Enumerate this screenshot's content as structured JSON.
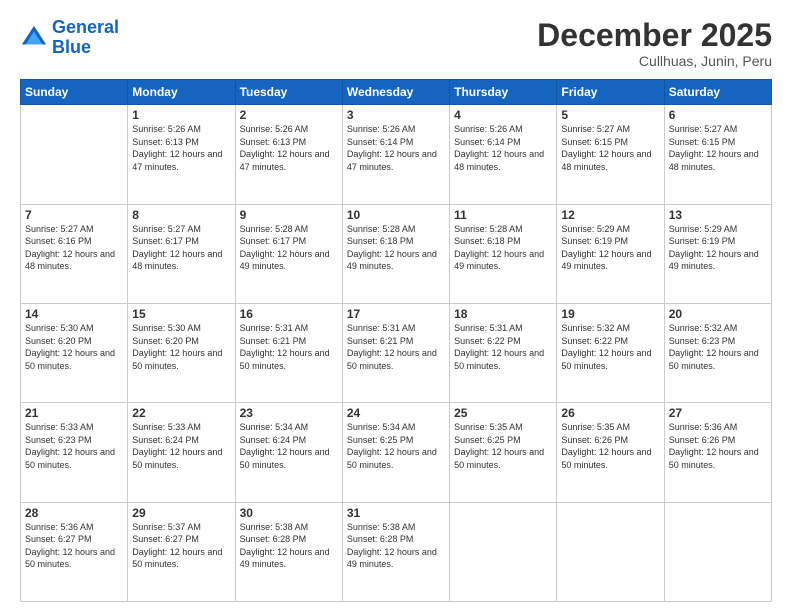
{
  "logo": {
    "line1": "General",
    "line2": "Blue"
  },
  "title": "December 2025",
  "subtitle": "Cullhuas, Junin, Peru",
  "weekdays": [
    "Sunday",
    "Monday",
    "Tuesday",
    "Wednesday",
    "Thursday",
    "Friday",
    "Saturday"
  ],
  "weeks": [
    [
      {
        "day": "",
        "sunrise": "",
        "sunset": "",
        "daylight": ""
      },
      {
        "day": "1",
        "sunrise": "Sunrise: 5:26 AM",
        "sunset": "Sunset: 6:13 PM",
        "daylight": "Daylight: 12 hours and 47 minutes."
      },
      {
        "day": "2",
        "sunrise": "Sunrise: 5:26 AM",
        "sunset": "Sunset: 6:13 PM",
        "daylight": "Daylight: 12 hours and 47 minutes."
      },
      {
        "day": "3",
        "sunrise": "Sunrise: 5:26 AM",
        "sunset": "Sunset: 6:14 PM",
        "daylight": "Daylight: 12 hours and 47 minutes."
      },
      {
        "day": "4",
        "sunrise": "Sunrise: 5:26 AM",
        "sunset": "Sunset: 6:14 PM",
        "daylight": "Daylight: 12 hours and 48 minutes."
      },
      {
        "day": "5",
        "sunrise": "Sunrise: 5:27 AM",
        "sunset": "Sunset: 6:15 PM",
        "daylight": "Daylight: 12 hours and 48 minutes."
      },
      {
        "day": "6",
        "sunrise": "Sunrise: 5:27 AM",
        "sunset": "Sunset: 6:15 PM",
        "daylight": "Daylight: 12 hours and 48 minutes."
      }
    ],
    [
      {
        "day": "7",
        "sunrise": "Sunrise: 5:27 AM",
        "sunset": "Sunset: 6:16 PM",
        "daylight": "Daylight: 12 hours and 48 minutes."
      },
      {
        "day": "8",
        "sunrise": "Sunrise: 5:27 AM",
        "sunset": "Sunset: 6:17 PM",
        "daylight": "Daylight: 12 hours and 48 minutes."
      },
      {
        "day": "9",
        "sunrise": "Sunrise: 5:28 AM",
        "sunset": "Sunset: 6:17 PM",
        "daylight": "Daylight: 12 hours and 49 minutes."
      },
      {
        "day": "10",
        "sunrise": "Sunrise: 5:28 AM",
        "sunset": "Sunset: 6:18 PM",
        "daylight": "Daylight: 12 hours and 49 minutes."
      },
      {
        "day": "11",
        "sunrise": "Sunrise: 5:28 AM",
        "sunset": "Sunset: 6:18 PM",
        "daylight": "Daylight: 12 hours and 49 minutes."
      },
      {
        "day": "12",
        "sunrise": "Sunrise: 5:29 AM",
        "sunset": "Sunset: 6:19 PM",
        "daylight": "Daylight: 12 hours and 49 minutes."
      },
      {
        "day": "13",
        "sunrise": "Sunrise: 5:29 AM",
        "sunset": "Sunset: 6:19 PM",
        "daylight": "Daylight: 12 hours and 49 minutes."
      }
    ],
    [
      {
        "day": "14",
        "sunrise": "Sunrise: 5:30 AM",
        "sunset": "Sunset: 6:20 PM",
        "daylight": "Daylight: 12 hours and 50 minutes."
      },
      {
        "day": "15",
        "sunrise": "Sunrise: 5:30 AM",
        "sunset": "Sunset: 6:20 PM",
        "daylight": "Daylight: 12 hours and 50 minutes."
      },
      {
        "day": "16",
        "sunrise": "Sunrise: 5:31 AM",
        "sunset": "Sunset: 6:21 PM",
        "daylight": "Daylight: 12 hours and 50 minutes."
      },
      {
        "day": "17",
        "sunrise": "Sunrise: 5:31 AM",
        "sunset": "Sunset: 6:21 PM",
        "daylight": "Daylight: 12 hours and 50 minutes."
      },
      {
        "day": "18",
        "sunrise": "Sunrise: 5:31 AM",
        "sunset": "Sunset: 6:22 PM",
        "daylight": "Daylight: 12 hours and 50 minutes."
      },
      {
        "day": "19",
        "sunrise": "Sunrise: 5:32 AM",
        "sunset": "Sunset: 6:22 PM",
        "daylight": "Daylight: 12 hours and 50 minutes."
      },
      {
        "day": "20",
        "sunrise": "Sunrise: 5:32 AM",
        "sunset": "Sunset: 6:23 PM",
        "daylight": "Daylight: 12 hours and 50 minutes."
      }
    ],
    [
      {
        "day": "21",
        "sunrise": "Sunrise: 5:33 AM",
        "sunset": "Sunset: 6:23 PM",
        "daylight": "Daylight: 12 hours and 50 minutes."
      },
      {
        "day": "22",
        "sunrise": "Sunrise: 5:33 AM",
        "sunset": "Sunset: 6:24 PM",
        "daylight": "Daylight: 12 hours and 50 minutes."
      },
      {
        "day": "23",
        "sunrise": "Sunrise: 5:34 AM",
        "sunset": "Sunset: 6:24 PM",
        "daylight": "Daylight: 12 hours and 50 minutes."
      },
      {
        "day": "24",
        "sunrise": "Sunrise: 5:34 AM",
        "sunset": "Sunset: 6:25 PM",
        "daylight": "Daylight: 12 hours and 50 minutes."
      },
      {
        "day": "25",
        "sunrise": "Sunrise: 5:35 AM",
        "sunset": "Sunset: 6:25 PM",
        "daylight": "Daylight: 12 hours and 50 minutes."
      },
      {
        "day": "26",
        "sunrise": "Sunrise: 5:35 AM",
        "sunset": "Sunset: 6:26 PM",
        "daylight": "Daylight: 12 hours and 50 minutes."
      },
      {
        "day": "27",
        "sunrise": "Sunrise: 5:36 AM",
        "sunset": "Sunset: 6:26 PM",
        "daylight": "Daylight: 12 hours and 50 minutes."
      }
    ],
    [
      {
        "day": "28",
        "sunrise": "Sunrise: 5:36 AM",
        "sunset": "Sunset: 6:27 PM",
        "daylight": "Daylight: 12 hours and 50 minutes."
      },
      {
        "day": "29",
        "sunrise": "Sunrise: 5:37 AM",
        "sunset": "Sunset: 6:27 PM",
        "daylight": "Daylight: 12 hours and 50 minutes."
      },
      {
        "day": "30",
        "sunrise": "Sunrise: 5:38 AM",
        "sunset": "Sunset: 6:28 PM",
        "daylight": "Daylight: 12 hours and 49 minutes."
      },
      {
        "day": "31",
        "sunrise": "Sunrise: 5:38 AM",
        "sunset": "Sunset: 6:28 PM",
        "daylight": "Daylight: 12 hours and 49 minutes."
      },
      {
        "day": "",
        "sunrise": "",
        "sunset": "",
        "daylight": ""
      },
      {
        "day": "",
        "sunrise": "",
        "sunset": "",
        "daylight": ""
      },
      {
        "day": "",
        "sunrise": "",
        "sunset": "",
        "daylight": ""
      }
    ]
  ]
}
